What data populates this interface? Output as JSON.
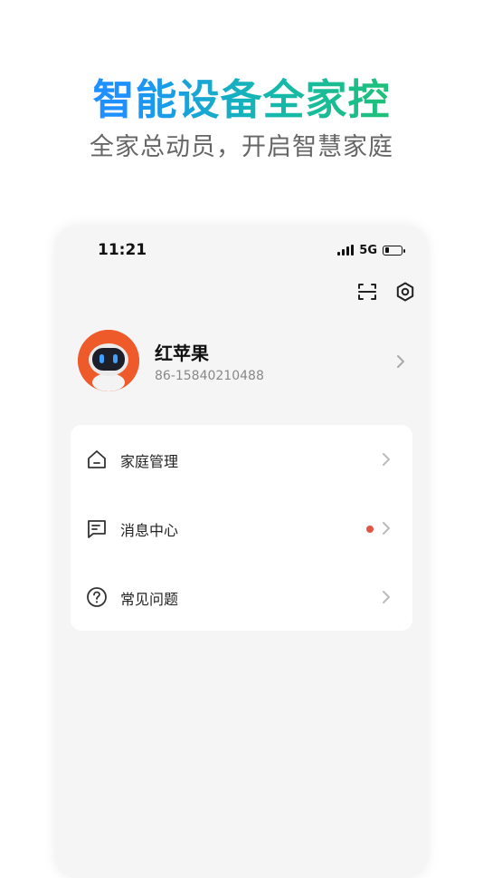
{
  "hero": {
    "title": "智能设备全家控",
    "subtitle": "全家总动员，开启智慧家庭"
  },
  "status_bar": {
    "time": "11:21",
    "network": "5G",
    "battery_level": 0.3
  },
  "profile": {
    "name": "红苹果",
    "phone": "86-15840210488"
  },
  "menu": {
    "items": [
      {
        "label": "家庭管理",
        "icon": "home-icon",
        "badge": false
      },
      {
        "label": "消息中心",
        "icon": "message-icon",
        "badge": true
      },
      {
        "label": "常见问题",
        "icon": "help-icon",
        "badge": false
      }
    ]
  },
  "colors": {
    "accent_blue": "#1e90ff",
    "accent_green": "#1fc07a",
    "badge_red": "#e05545",
    "avatar_orange": "#ee5a2a"
  }
}
